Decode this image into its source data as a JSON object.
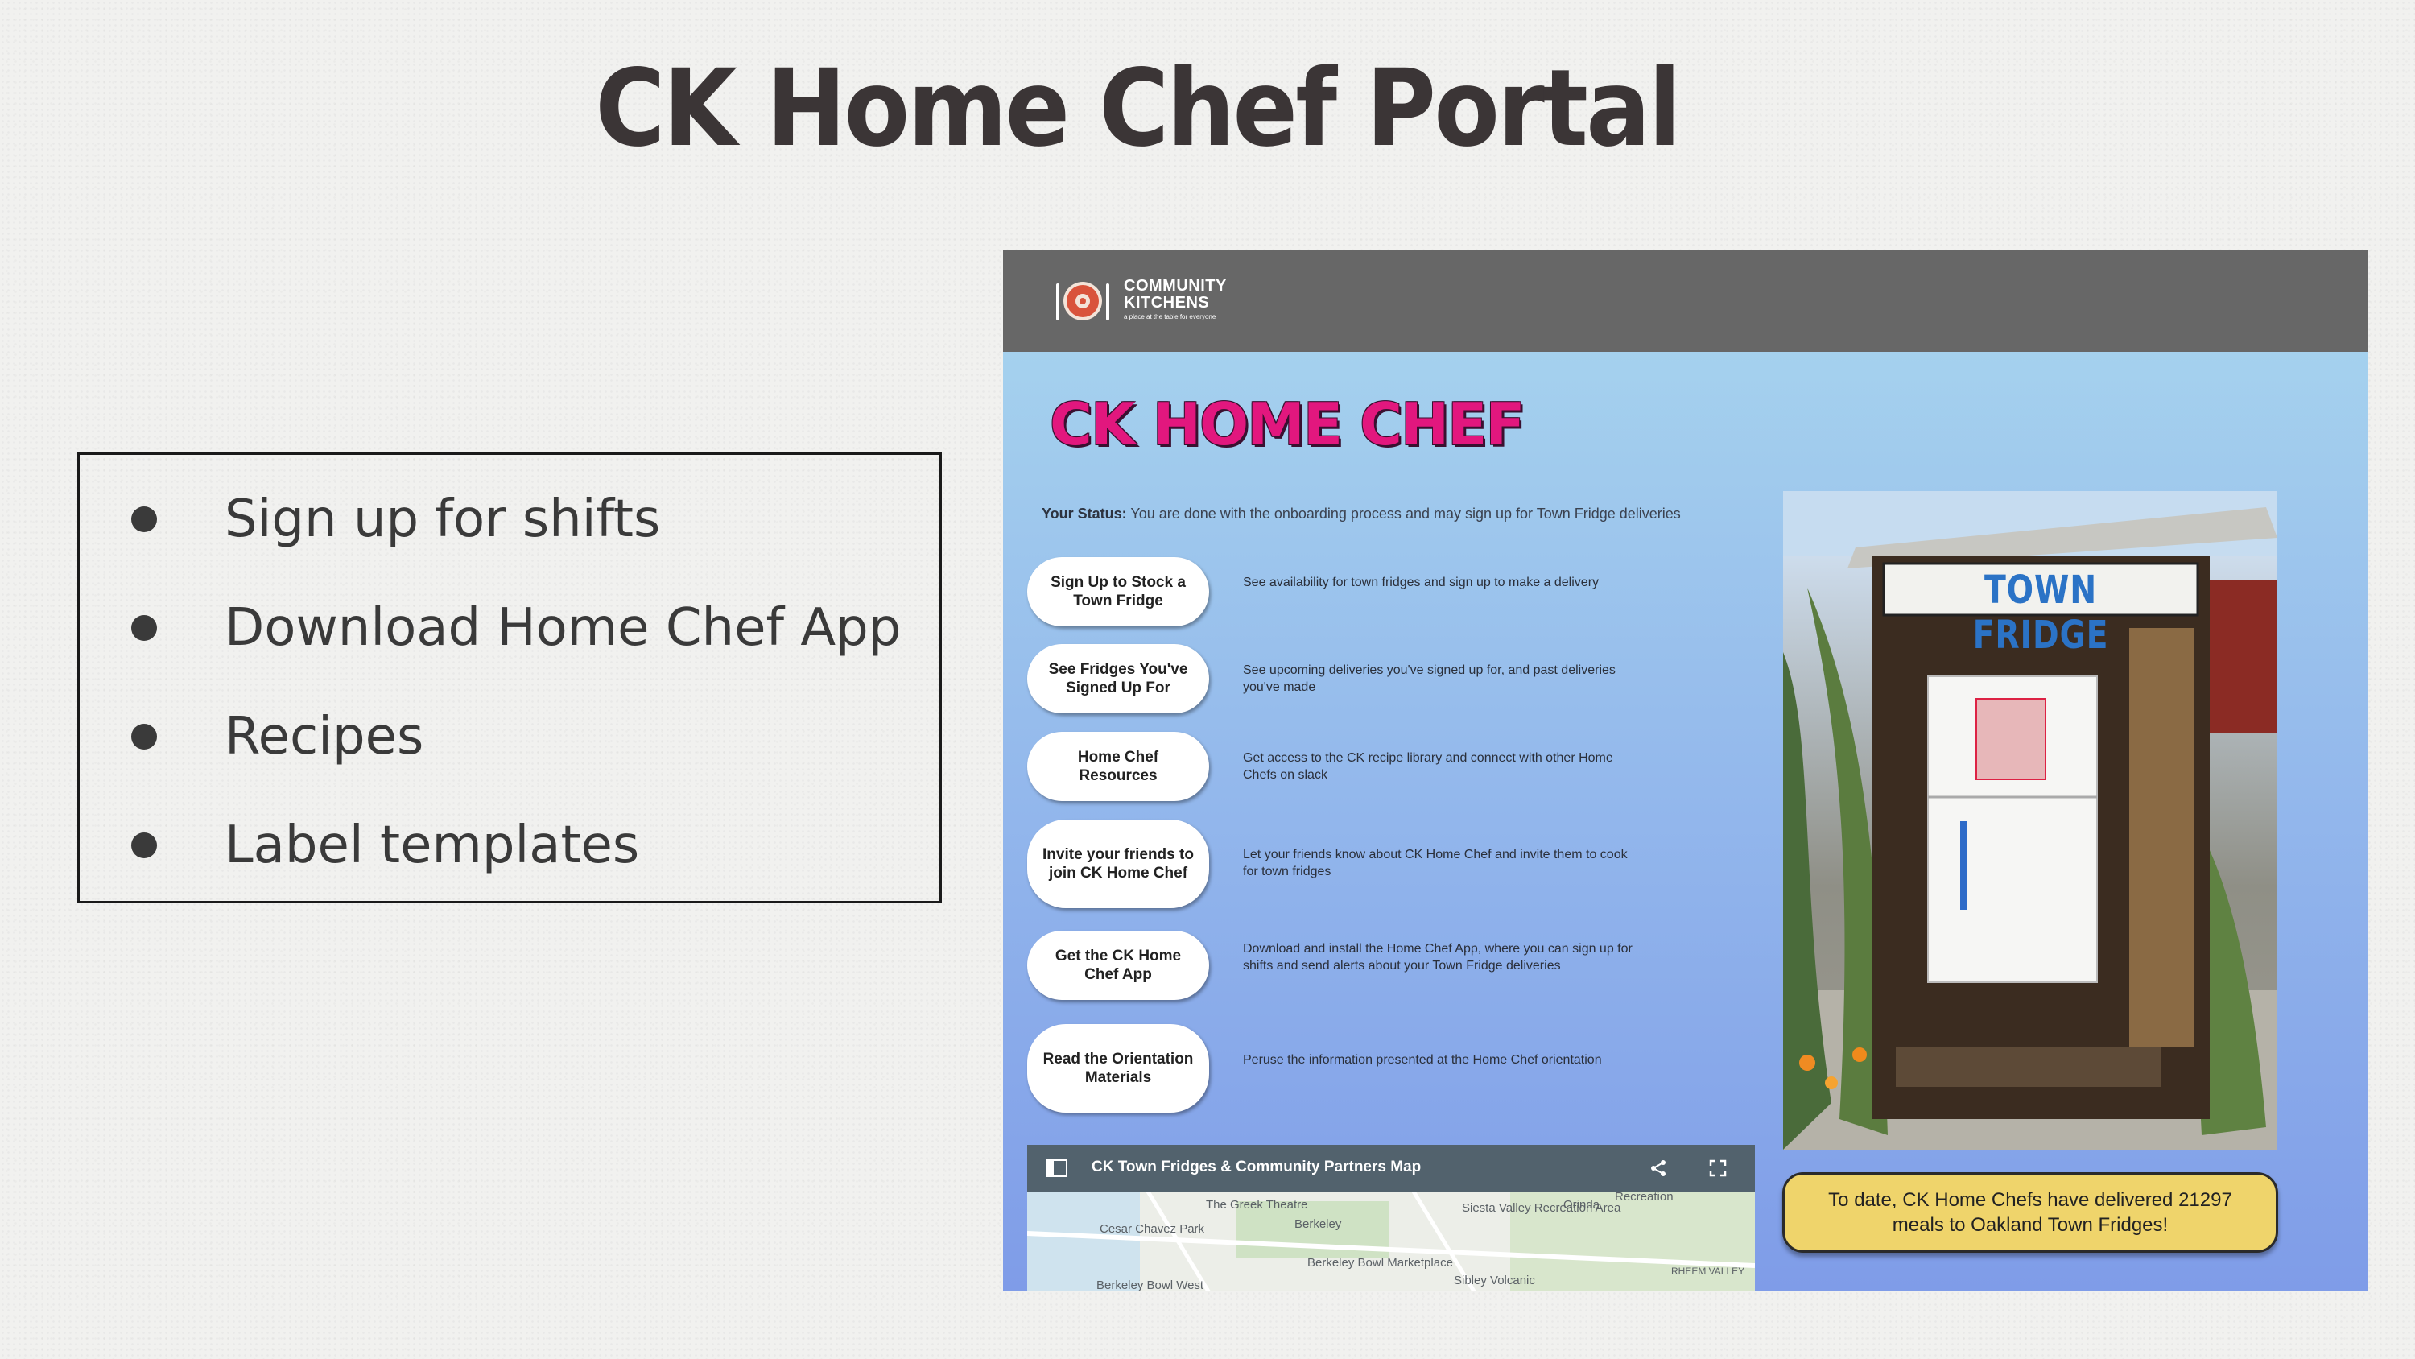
{
  "slide": {
    "title": "CK Home Chef Portal",
    "bullets": [
      "Sign up for shifts",
      "Download Home Chef App",
      "Recipes",
      "Label templates"
    ]
  },
  "portal": {
    "header": {
      "logo_line1": "COMMUNITY",
      "logo_line2": "KITCHENS",
      "logo_tagline": "a place at the table for everyone",
      "bg_color": "#676767"
    },
    "title": "CK HOME CHEF",
    "title_color": "#e2177e",
    "status_label": "Your Status:",
    "status_text": "You are done with the onboarding process and may sign up for Town Fridge deliveries",
    "actions": [
      {
        "label": "Sign Up to Stock a Town Fridge",
        "description": "See availability for town fridges and sign up to make a delivery"
      },
      {
        "label": "See Fridges You've Signed Up For",
        "description": "See upcoming deliveries you've signed up for, and past deliveries you've made"
      },
      {
        "label": "Home Chef Resources",
        "description": "Get access to the CK recipe library and connect with other Home Chefs on slack"
      },
      {
        "label": "Invite your friends to join CK Home Chef",
        "description": "Let your friends know about CK Home Chef and invite them to cook for town fridges"
      },
      {
        "label": "Get the CK Home Chef App",
        "description": "Download and install the Home Chef App, where you can sign up for shifts and send alerts about your Town Fridge deliveries"
      },
      {
        "label": "Read the Orientation Materials",
        "description": "Peruse the information presented at the Home Chef orientation"
      }
    ],
    "photo_sign": "TOWN FRIDGE",
    "stat_text": "To date, CK Home Chefs have delivered 21297 meals to Oakland Town Fridges!",
    "map": {
      "title": "CK Town Fridges & Community Partners Map",
      "labels": [
        "The Greek Theatre",
        "Berkeley",
        "Cesar Chavez Park",
        "Siesta Valley Recreation Area",
        "Orinda",
        "Recreation",
        "Berkeley Bowl Marketplace",
        "Berkeley Bowl West",
        "Sibley Volcanic",
        "RHEEM VALLEY"
      ]
    }
  }
}
